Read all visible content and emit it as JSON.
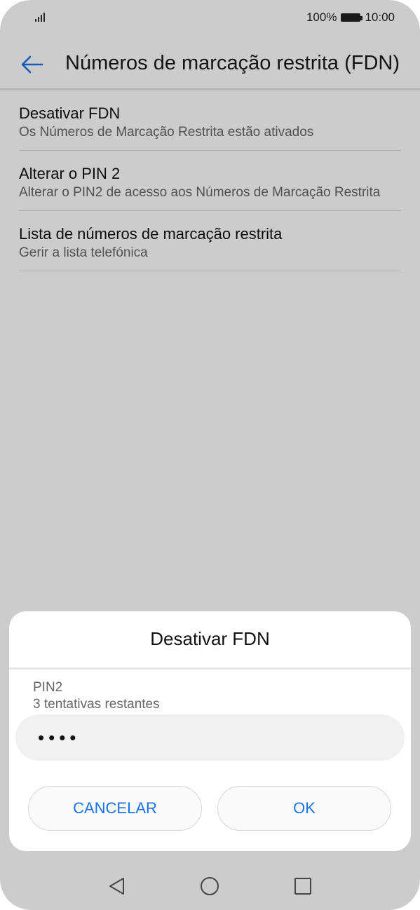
{
  "status": {
    "battery_percent": "100%",
    "time": "10:00"
  },
  "appbar": {
    "title": "Números de marcação restrita (FDN)"
  },
  "list": [
    {
      "title": "Desativar FDN",
      "subtitle": "Os Números de Marcação Restrita estão ativados"
    },
    {
      "title": "Alterar o PIN 2",
      "subtitle": "Alterar o PIN2 de acesso aos Números de Marcação Restrita"
    },
    {
      "title": "Lista de números de marcação restrita",
      "subtitle": "Gerir a lista telefónica"
    }
  ],
  "dialog": {
    "title": "Desativar FDN",
    "field_label": "PIN2",
    "attempts": "3 tentativas restantes",
    "pin_value": "••••",
    "cancel_label": "CANCELAR",
    "ok_label": "OK"
  },
  "colors": {
    "accent": "#1a73e8"
  },
  "icons": {
    "back": "arrow-left",
    "nav_back": "triangle-left",
    "nav_home": "circle",
    "nav_recents": "square"
  }
}
